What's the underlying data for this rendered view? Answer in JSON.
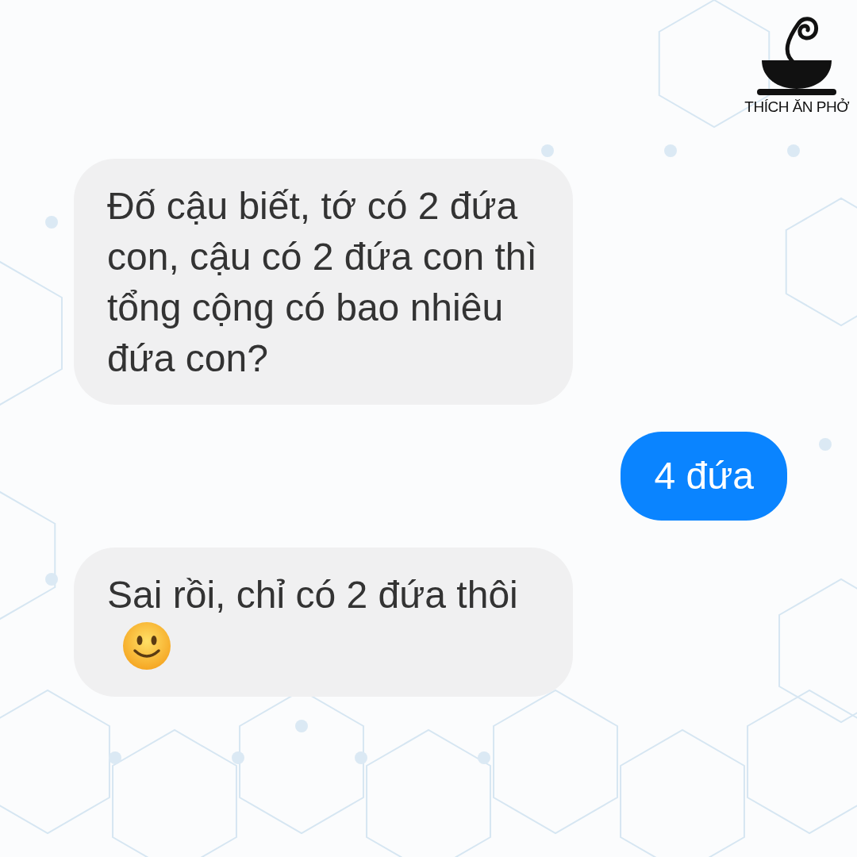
{
  "logo": {
    "text": "THÍCH ĂN PHỞ"
  },
  "messages": [
    {
      "kind": "incoming",
      "text": "Đố cậu biết, tớ có 2 đứa con, cậu có 2 đứa con thì tổng cộng có bao nhiêu đứa con?",
      "emoji": false
    },
    {
      "kind": "outgoing",
      "text": "4 đứa",
      "emoji": false
    },
    {
      "kind": "incoming",
      "text": "Sai rồi, chỉ có 2 đứa thôi",
      "emoji": true
    }
  ]
}
